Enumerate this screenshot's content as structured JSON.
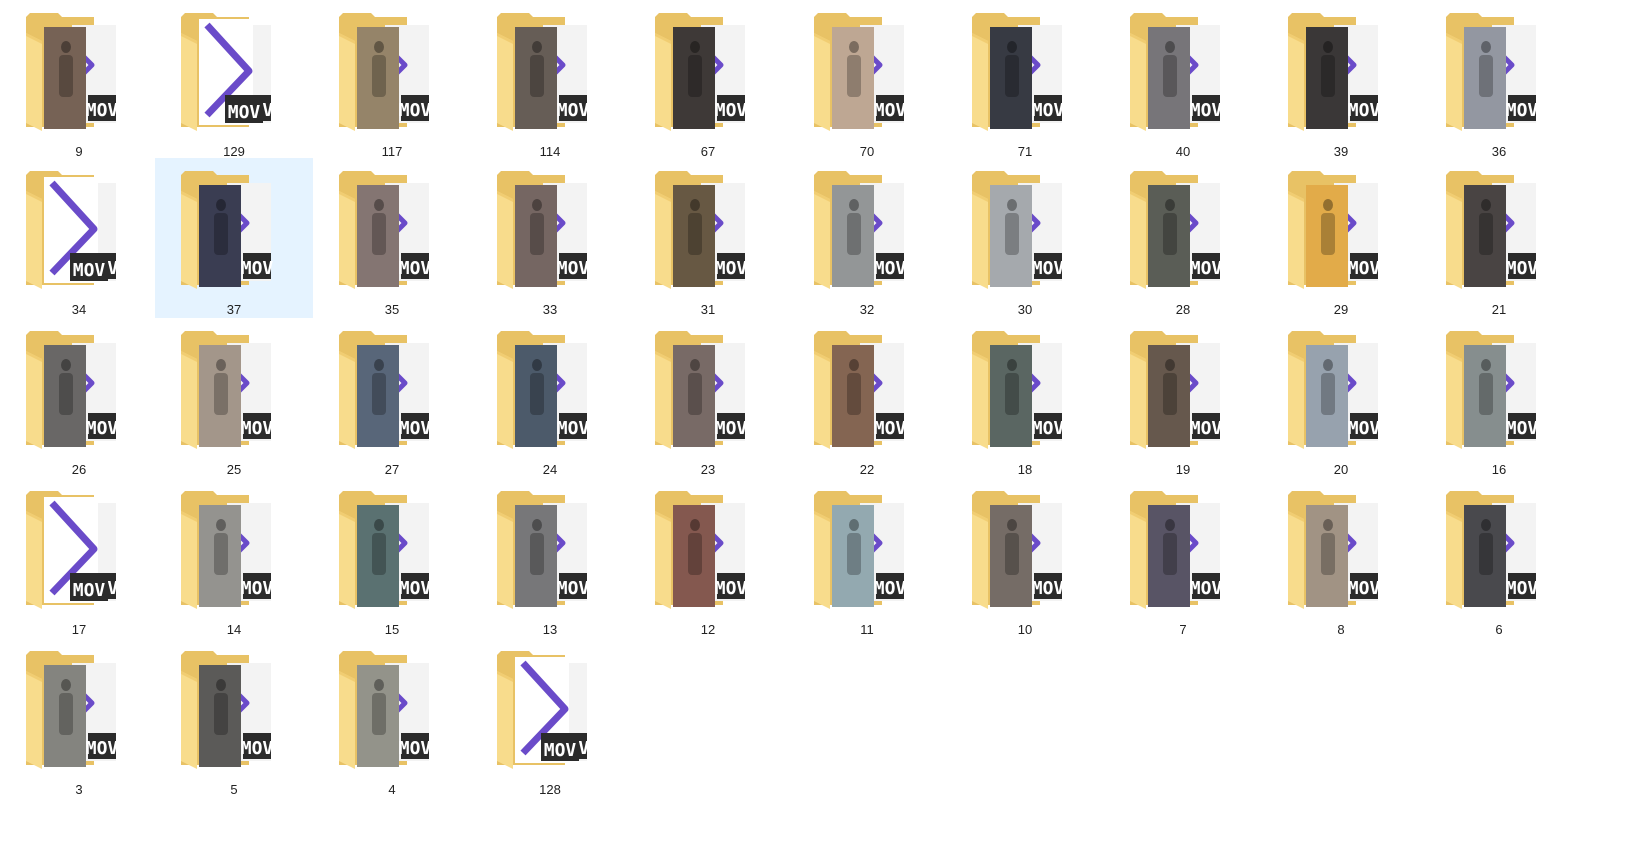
{
  "folder_colors": {
    "back": "#e8c265",
    "front": "#f8dc8c",
    "front_edge": "#f1cd72",
    "doc": "#f3f3f3",
    "play": "#6a4bc9",
    "mov_bg": "#2b2b2b",
    "mov_text": "#ffffff"
  },
  "selection_color": "#e5f3ff",
  "folders": [
    {
      "name": "9",
      "thumb": "photo",
      "tone": "#6b5547"
    },
    {
      "name": "129",
      "thumb": "mov"
    },
    {
      "name": "117",
      "thumb": "photo",
      "tone": "#8d7a5d"
    },
    {
      "name": "114",
      "thumb": "photo",
      "tone": "#5a5048"
    },
    {
      "name": "67",
      "thumb": "photo",
      "tone": "#2e2927"
    },
    {
      "name": "70",
      "thumb": "photo",
      "tone": "#b9a08a"
    },
    {
      "name": "71",
      "thumb": "photo",
      "tone": "#262a33"
    },
    {
      "name": "40",
      "thumb": "photo",
      "tone": "#6c6a6e"
    },
    {
      "name": "39",
      "thumb": "photo",
      "tone": "#2a2627"
    },
    {
      "name": "36",
      "thumb": "photo",
      "tone": "#8a8f99"
    },
    {
      "name": "34",
      "thumb": "mov"
    },
    {
      "name": "37",
      "thumb": "photo",
      "tone": "#2a2d44",
      "selected": true
    },
    {
      "name": "35",
      "thumb": "photo",
      "tone": "#7a6a66"
    },
    {
      "name": "33",
      "thumb": "photo",
      "tone": "#6a5a55"
    },
    {
      "name": "31",
      "thumb": "photo",
      "tone": "#5b4a33"
    },
    {
      "name": "32",
      "thumb": "photo",
      "tone": "#8a8e8f"
    },
    {
      "name": "30",
      "thumb": "photo",
      "tone": "#9ea2a6"
    },
    {
      "name": "28",
      "thumb": "photo",
      "tone": "#4c5048"
    },
    {
      "name": "29",
      "thumb": "photo",
      "tone": "#e0a43a"
    },
    {
      "name": "21",
      "thumb": "photo",
      "tone": "#3a3534"
    },
    {
      "name": "26",
      "thumb": "photo",
      "tone": "#5d5b5a"
    },
    {
      "name": "25",
      "thumb": "photo",
      "tone": "#9c8e80"
    },
    {
      "name": "27",
      "thumb": "photo",
      "tone": "#4a5a6e"
    },
    {
      "name": "24",
      "thumb": "photo",
      "tone": "#3d4d5e"
    },
    {
      "name": "23",
      "thumb": "photo",
      "tone": "#6d5e5a"
    },
    {
      "name": "22",
      "thumb": "photo",
      "tone": "#7a5844"
    },
    {
      "name": "18",
      "thumb": "photo",
      "tone": "#4d5a55"
    },
    {
      "name": "19",
      "thumb": "photo",
      "tone": "#5a4a3e"
    },
    {
      "name": "20",
      "thumb": "photo",
      "tone": "#8f9ba8"
    },
    {
      "name": "16",
      "thumb": "photo",
      "tone": "#7c8585"
    },
    {
      "name": "17",
      "thumb": "mov"
    },
    {
      "name": "14",
      "thumb": "photo",
      "tone": "#8b8a86"
    },
    {
      "name": "15",
      "thumb": "photo",
      "tone": "#4c6565"
    },
    {
      "name": "13",
      "thumb": "photo",
      "tone": "#6c6c6e"
    },
    {
      "name": "12",
      "thumb": "photo",
      "tone": "#7a4a40"
    },
    {
      "name": "11",
      "thumb": "photo",
      "tone": "#8aa2aa"
    },
    {
      "name": "10",
      "thumb": "photo",
      "tone": "#6a605a"
    },
    {
      "name": "7",
      "thumb": "photo",
      "tone": "#4a4658"
    },
    {
      "name": "8",
      "thumb": "photo",
      "tone": "#9a8a7a"
    },
    {
      "name": "6",
      "thumb": "photo",
      "tone": "#3a3a3e"
    },
    {
      "name": "3",
      "thumb": "photo",
      "tone": "#7a7a75"
    },
    {
      "name": "5",
      "thumb": "photo",
      "tone": "#4e4c4a"
    },
    {
      "name": "4",
      "thumb": "photo",
      "tone": "#8a8a80"
    },
    {
      "name": "128",
      "thumb": "mov"
    }
  ]
}
